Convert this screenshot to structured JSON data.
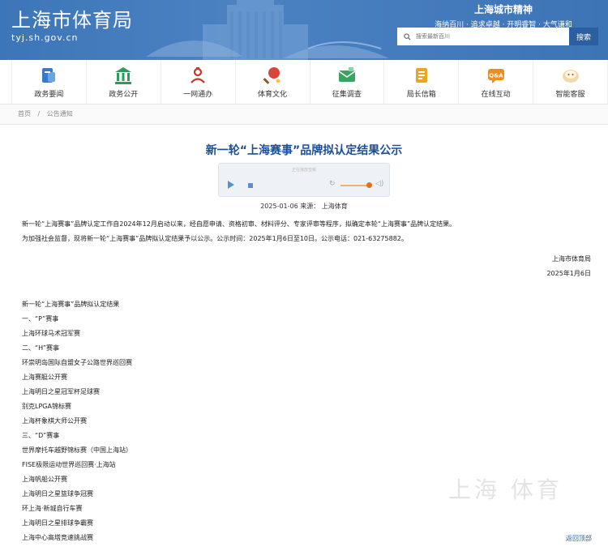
{
  "header": {
    "logo_text": "上海市体育局",
    "logo_url": "tyj.sh.gov.cn",
    "slogan_title": "上海城市精神",
    "slogan_sub": "海纳百川 · 追求卓越 · 开明睿智 · 大气谦和",
    "search_placeholder": "搜索最新百川",
    "search_button": "搜索"
  },
  "nav": [
    {
      "label": "政务要闻",
      "icon": "news-icon",
      "color": "#3a78c8"
    },
    {
      "label": "政务公开",
      "icon": "building-icon",
      "color": "#2e9a5c"
    },
    {
      "label": "一网通办",
      "icon": "service-icon",
      "color": "#c0392b"
    },
    {
      "label": "体育文化",
      "icon": "ping-pong-icon",
      "color": "#d9453a"
    },
    {
      "label": "征集调查",
      "icon": "envelope-icon",
      "color": "#3aa35f"
    },
    {
      "label": "局长信箱",
      "icon": "mailbox-icon",
      "color": "#e8a624"
    },
    {
      "label": "在线互动",
      "icon": "qa-icon",
      "color": "#f08c1f"
    },
    {
      "label": "智能客服",
      "icon": "robot-icon",
      "color": "#e0a458"
    }
  ],
  "breadcrumb": {
    "home": "首页",
    "sep": "/",
    "current": "公告通知"
  },
  "article": {
    "title": "新一轮“上海赛事”品牌拟认定结果公示",
    "audio_label": "正在播放音频",
    "meta": "2025-01-06 来源： 上海体育",
    "para1": "新一轮“上海赛事”品牌认定工作自2024年12月启动以来，经自愿申请、资格初审、材料评分、专家评审等程序，拟确定本轮“上海赛事”品牌认定结果。",
    "para2": "为加强社会监督，现将新一轮“上海赛事”品牌拟认定结果予以公示。公示时间：2025年1月6日至10日。公示电话：021-63275882。",
    "signature": "上海市体育局",
    "date": "2025年1月6日",
    "results": [
      "新一轮“上海赛事”品牌拟认定结果",
      "一、“P”赛事",
      "上海环球马术冠军赛",
      "二、“H”赛事",
      "环崇明岛国际自盟女子公路世界巡回赛",
      "上海赛艇公开赛",
      "上海明日之星冠军杯足球赛",
      "别克LPGA锦标赛",
      "上海杯象棋大师公开赛",
      "三、“D”赛事",
      "世界摩托车越野锦标赛（中国上海站）",
      "FISE极限运动世界巡回赛·上海站",
      "上海帆船公开赛",
      "上海明日之星篮球争冠赛",
      "环上海·新城自行车赛",
      "上海明日之星排球争霸赛",
      "上海中心高塔竞速挑战赛"
    ],
    "back_top": "返回顶部",
    "watermark": "上海 体育"
  }
}
